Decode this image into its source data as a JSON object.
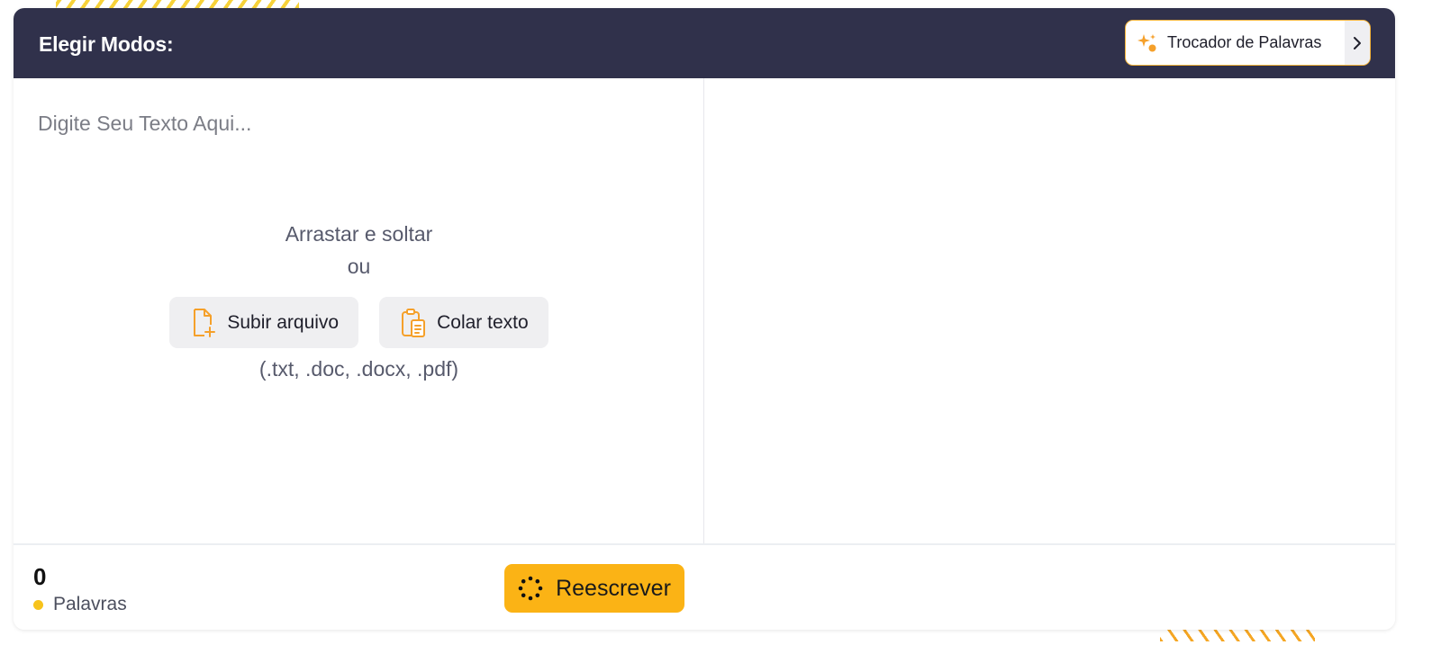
{
  "header": {
    "title": "Elegir Modos:",
    "mode": {
      "label": "Trocador de Palavras",
      "icon": "sparkle-icon"
    },
    "arrow_icon": "chevron-right-icon"
  },
  "input": {
    "placeholder": "Digite Seu Texto Aqui..."
  },
  "dropzone": {
    "drag_text": "Arrastar e soltar",
    "or_text": "ou",
    "upload_label": "Subir arquivo",
    "upload_icon": "file-add-icon",
    "paste_label": "Colar texto",
    "paste_icon": "clipboard-icon",
    "formats": "(.txt, .doc, .docx, .pdf)"
  },
  "footer": {
    "word_count": "0",
    "word_label": "Palavras",
    "rewrite_label": "Reescrever",
    "rewrite_icon": "spinner-icon"
  },
  "colors": {
    "header_bg": "#30314b",
    "accent": "#fbb315",
    "icon_orange": "#f5a02a",
    "dot": "#f7c31c"
  }
}
